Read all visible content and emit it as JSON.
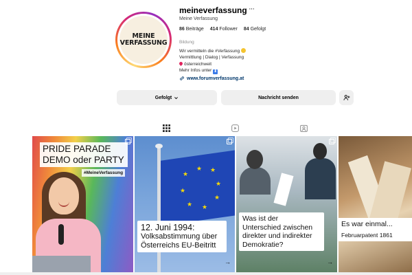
{
  "profile": {
    "avatar_text_line1": "MEINE",
    "avatar_text_line2": "VERFASSUNG",
    "username": "meineverfassung",
    "more_icon": "more-dots",
    "full_name": "Meine Verfassung",
    "stats": {
      "posts_count": "86",
      "posts_label": "Beiträge",
      "followers_count": "414",
      "followers_label": "Follower",
      "following_count": "84",
      "following_label": "Gefolgt"
    },
    "category": "Bildung",
    "bio_line1": "Wir vermitteln die #Verfassung",
    "bio_line2": "Vermittlung | Dialog | Verfassung",
    "bio_line3": "österreichweit",
    "bio_line4": "Mehr Infos unter",
    "link": "www.forumverfassung.at"
  },
  "actions": {
    "follow_label": "Gefolgt",
    "message_label": "Nachricht senden",
    "suggest_icon": "add-person-icon"
  },
  "tabs": [
    {
      "icon": "grid-icon",
      "active": true
    },
    {
      "icon": "reels-icon",
      "active": false
    },
    {
      "icon": "tagged-icon",
      "active": false
    }
  ],
  "posts": [
    {
      "title_line1": "PRIDE PARADE",
      "title_line2": "DEMO oder PARTY",
      "hashtag": "#MeineVerfassung"
    },
    {
      "line1": "12. Juni 1994:",
      "line2": "Volksabstimmung über",
      "line3": "Österreichs EU-Beitritt",
      "arrow": "→"
    },
    {
      "line1": "Was ist der",
      "line2": "Unterschied zwischen",
      "line3": "direkter und indirekter",
      "line4": "Demokratie?",
      "arrow": "→"
    },
    {
      "line1": "Es war einmal...",
      "line2": "Februarpatent 1861"
    }
  ],
  "colors": {
    "link": "#00376b",
    "button_bg": "#efefef",
    "ring_gradient_start": "#feda75",
    "ring_gradient_mid": "#d62976"
  }
}
